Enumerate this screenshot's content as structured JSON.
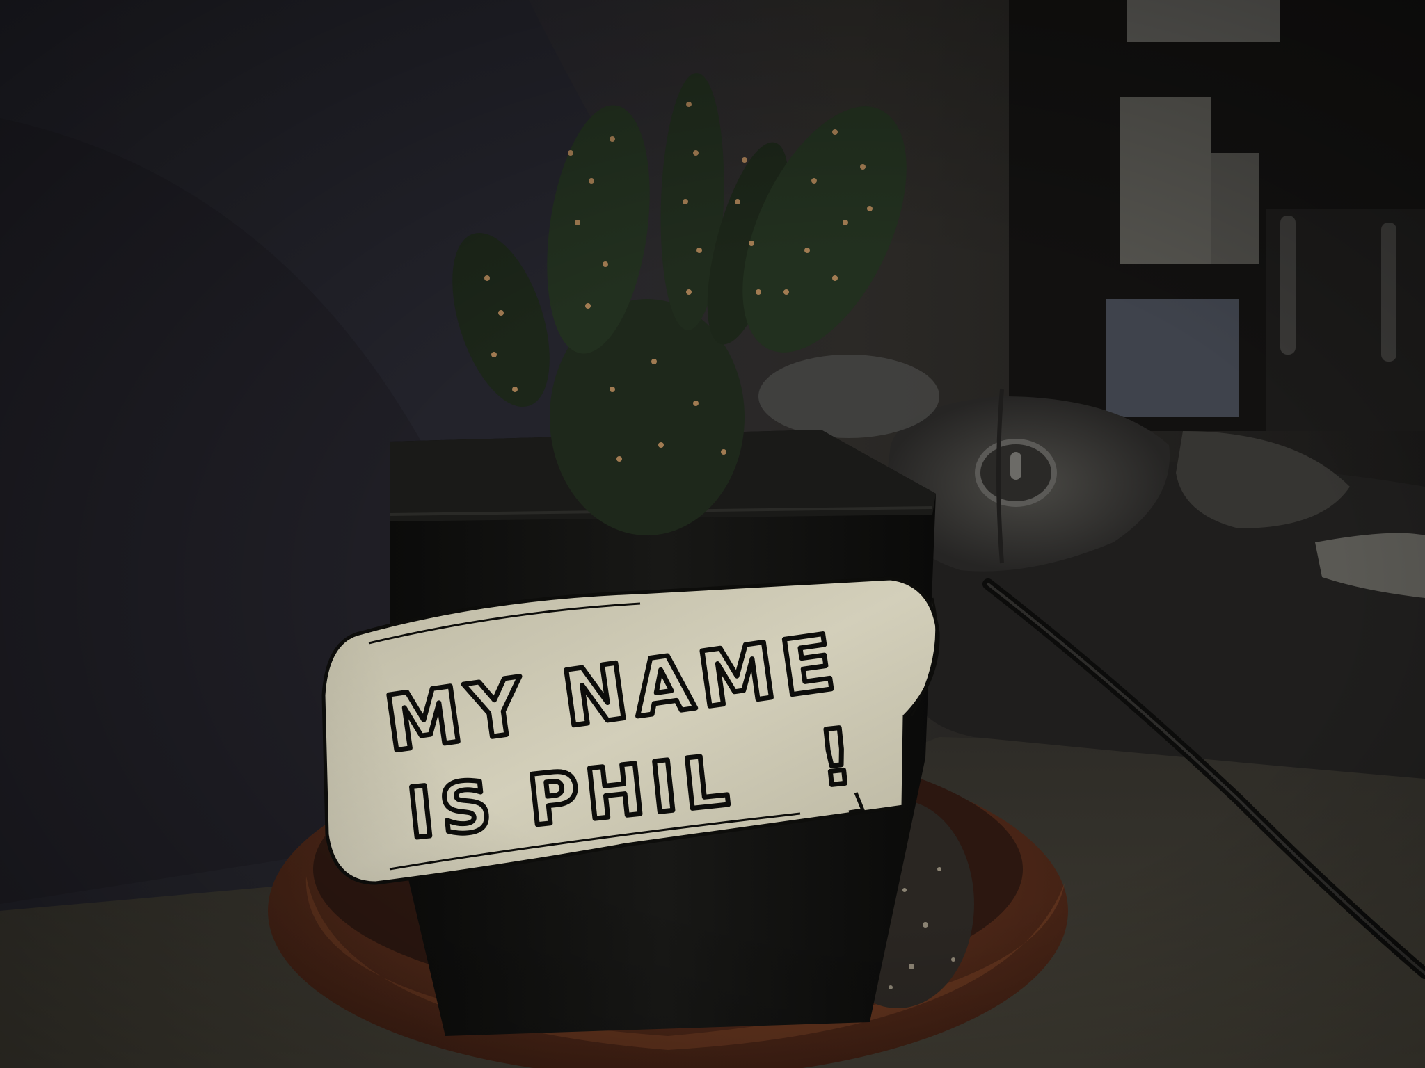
{
  "photo": {
    "subject": "potted cactus",
    "sign": {
      "line1": "MY NAME",
      "line2": "IS PHIL",
      "punctuation": "!"
    },
    "colors": {
      "background_wall": "#23222a",
      "desk": "#3a372f",
      "cactus": "#1f2a1c",
      "areole": "#b98a5c",
      "pot": "#0f0f0e",
      "saucer": "#5a2f1c",
      "sign_paper": "#cfcbb6",
      "ink": "#0d0d0b",
      "mouse": "#3d3c3a"
    }
  }
}
